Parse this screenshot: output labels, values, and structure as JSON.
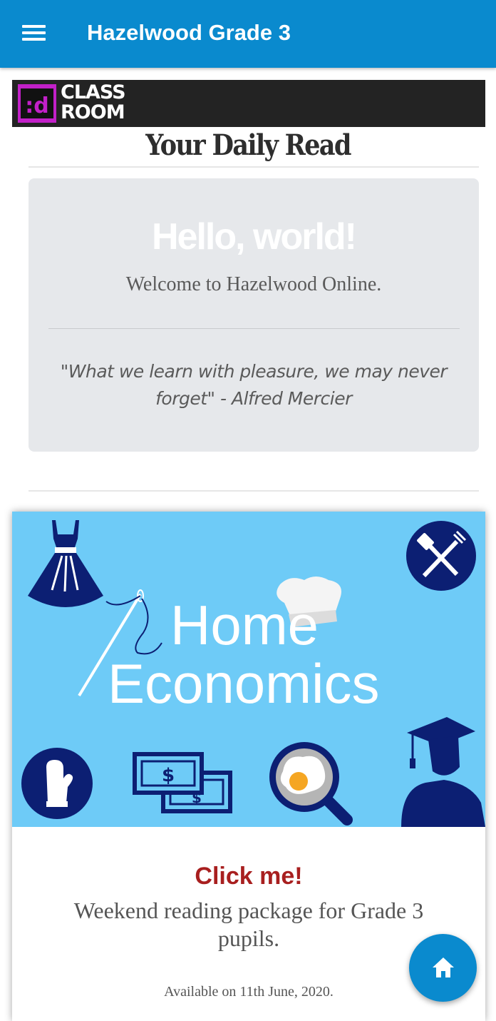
{
  "app_bar": {
    "title": "Hazelwood Grade 3",
    "menu_icon": "hamburger-menu-icon",
    "background": "#0a8ace"
  },
  "banner": {
    "logo_glyph": ":d",
    "logo_line1": "CLASS",
    "logo_line2": "ROOM",
    "logo_color": "#c220c8"
  },
  "daily": {
    "heading": "Your Daily Read",
    "jumbotron": {
      "headline": "Hello, world!",
      "welcome": "Welcome to Hazelwood Online.",
      "quote": "\"What we learn with pleasure, we may never forget\" - Alfred Mercier"
    }
  },
  "course_card": {
    "image_title_line1": "Home",
    "image_title_line2": "Economics",
    "image_icons": [
      "dress-icon",
      "spatula-fork-icon",
      "chef-hat-icon",
      "needle-thread-icon",
      "oven-mitt-icon",
      "dollar-bills-icon",
      "frying-pan-egg-icon",
      "graduate-icon"
    ],
    "image_background": "#6ecbf7",
    "link_text": "Click me!",
    "link_color": "#a81f1f",
    "description": "Weekend reading package for Grade 3 pupils.",
    "availability": "Available on 11th June, 2020."
  },
  "fab": {
    "icon": "home-icon"
  }
}
